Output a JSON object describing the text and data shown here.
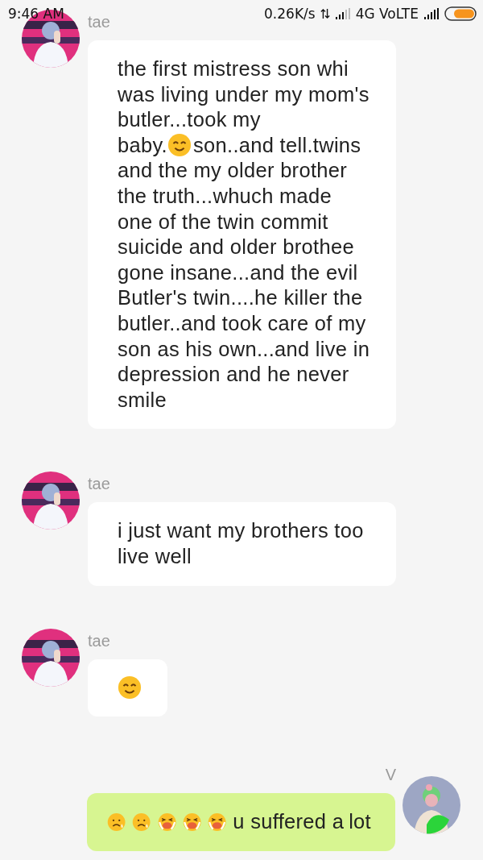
{
  "status_bar": {
    "time": "9:46 AM",
    "speed": "0.26K/s",
    "network": "4G VoLTE"
  },
  "messages": [
    {
      "mine": false,
      "sender": "tae",
      "parts": [
        {
          "kind": "text",
          "text": "the first mistress son whi was living under my mom's butler...took my"
        },
        {
          "kind": "text",
          "text": "baby."
        },
        {
          "kind": "smile"
        },
        {
          "kind": "text",
          "text": "son..and tell.twins"
        },
        {
          "kind": "text",
          "text": "and the my older brother the truth...whuch made one of the twin commit suicide and older brothee gone insane...and the evil Butler's twin....he killer the butler..and took care of my son as his own...and live in depression and he never smile"
        }
      ]
    },
    {
      "mine": false,
      "sender": "tae",
      "parts": [
        {
          "kind": "text",
          "text": "i just want my brothers too live well"
        }
      ]
    },
    {
      "mine": false,
      "sender": "tae",
      "parts": [
        {
          "kind": "smile"
        }
      ]
    },
    {
      "mine": true,
      "sender": "V",
      "parts": [
        {
          "kind": "sad"
        },
        {
          "kind": "sad"
        },
        {
          "kind": "crying"
        },
        {
          "kind": "crying"
        },
        {
          "kind": "crying"
        },
        {
          "kind": "text",
          "text": "u suffered a"
        },
        {
          "kind": "text",
          "text": "lot"
        }
      ]
    }
  ]
}
